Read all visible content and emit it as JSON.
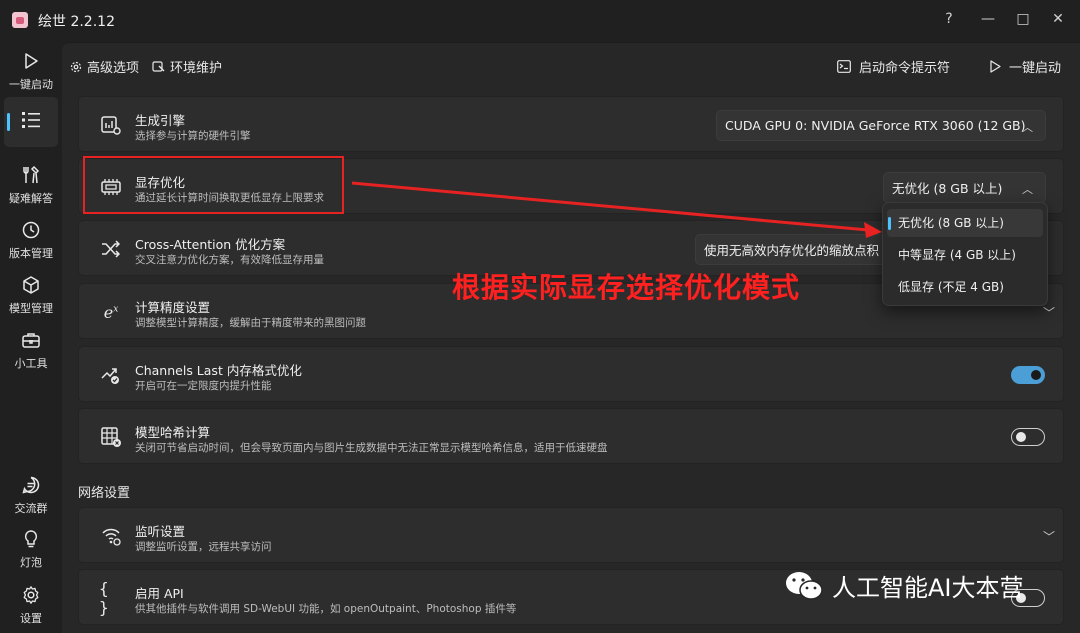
{
  "window": {
    "title": "绘世 2.2.12",
    "controls": [
      "?",
      "—",
      "□",
      "✕"
    ]
  },
  "nav": {
    "items": [
      {
        "label": "一键启动",
        "icon": "play-icon"
      },
      {
        "label": "",
        "icon": "list-icon",
        "active": true
      },
      {
        "label": "疑难解答",
        "icon": "tools-icon"
      },
      {
        "label": "版本管理",
        "icon": "history-icon"
      },
      {
        "label": "模型管理",
        "icon": "cube-icon"
      },
      {
        "label": "小工具",
        "icon": "toolbox-icon"
      },
      {
        "label": "交流群",
        "icon": "chat-icon"
      },
      {
        "label": "灯泡",
        "icon": "bulb-icon"
      },
      {
        "label": "设置",
        "icon": "gear-icon"
      }
    ]
  },
  "topbar": {
    "tabs": [
      {
        "label": "高级选项",
        "icon": "gear-small-icon"
      },
      {
        "label": "环境维护",
        "icon": "maintenance-icon"
      }
    ],
    "cmd_label": "启动命令提示符",
    "launch_label": "一键启动"
  },
  "settings": [
    {
      "title": "生成引擎",
      "desc": "选择参与计算的硬件引擎",
      "icon": "engine-icon",
      "control": "combo",
      "value": "CUDA GPU 0: NVIDIA GeForce RTX 3060 (12 GB)"
    },
    {
      "title": "显存优化",
      "desc": "通过延长计算时间换取更低显存上限要求",
      "icon": "memory-chip-icon",
      "control": "combo",
      "value": "无优化 (8 GB 以上)"
    },
    {
      "title": "Cross-Attention 优化方案",
      "desc": "交叉注意力优化方案，有效降低显存用量",
      "icon": "shuffle-icon",
      "control": "combo",
      "value": "使用无高效内存优化的缩放点积 (SDP)"
    },
    {
      "title": "计算精度设置",
      "desc": "调整模型计算精度，缓解由于精度带来的黑图问题",
      "icon": "precision-icon",
      "control": "expander"
    },
    {
      "title": "Channels Last 内存格式优化",
      "desc": "开启可在一定限度内提升性能",
      "icon": "trend-check-icon",
      "control": "toggle",
      "on": true
    },
    {
      "title": "模型哈希计算",
      "desc": "关闭可节省启动时间，但会导致页面内与图片生成数据中无法正常显示模型哈希信息，适用于低速硬盘",
      "icon": "hash-table-icon",
      "control": "toggle",
      "on": false
    }
  ],
  "network": {
    "section_title": "网络设置",
    "items": [
      {
        "title": "监听设置",
        "desc": "调整监听设置，远程共享访问",
        "icon": "wireless-icon",
        "control": "expander"
      },
      {
        "title": "启用 API",
        "desc": "供其他插件与软件调用 SD-WebUI 功能，如 openOutpaint、Photoshop 插件等",
        "icon": "braces-icon",
        "control": "toggle",
        "on": false
      }
    ]
  },
  "dropdown": {
    "options": [
      "无优化 (8 GB 以上)",
      "中等显存 (4 GB 以上)",
      "低显存 (不足 4 GB)"
    ],
    "selected_index": 0
  },
  "annotation": {
    "text": "根据实际显存选择优化模式",
    "color": "#ff2020"
  },
  "watermark": {
    "text": "人工智能AI大本营"
  },
  "colors": {
    "accent": "#4cc2ff",
    "toggle_on": "#4b9fd6",
    "annotation_red": "#e62222"
  }
}
